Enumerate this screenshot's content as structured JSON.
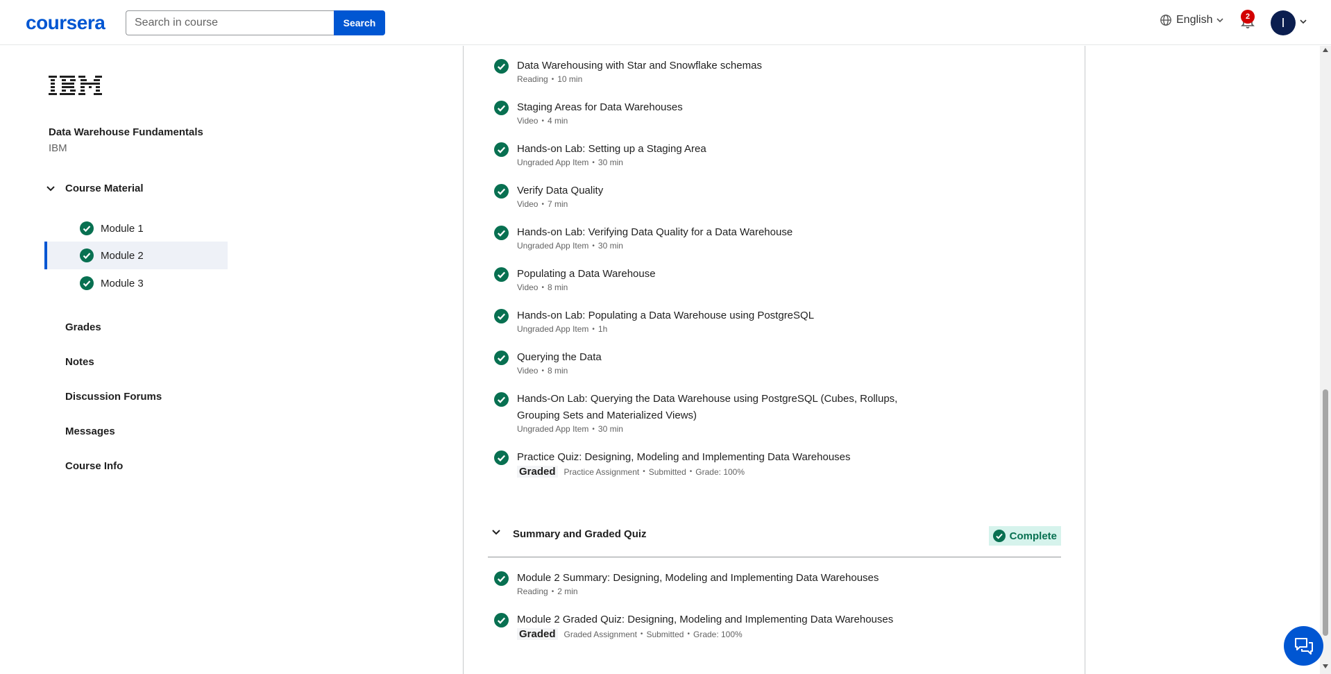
{
  "header": {
    "logo": "coursera",
    "search_placeholder": "Search in course",
    "search_button": "Search",
    "language": "English",
    "notifications_count": "2",
    "avatar_initial": "I"
  },
  "sidebar": {
    "course_title": "Data Warehouse Fundamentals",
    "course_org": "IBM",
    "course_material_label": "Course Material",
    "modules": [
      {
        "label": "Module 1",
        "completed": true,
        "active": false
      },
      {
        "label": "Module 2",
        "completed": true,
        "active": true
      },
      {
        "label": "Module 3",
        "completed": true,
        "active": false
      }
    ],
    "nav": [
      "Grades",
      "Notes",
      "Discussion Forums",
      "Messages",
      "Course Info"
    ]
  },
  "items": [
    {
      "title": "Data Warehousing with Star and Snowflake schemas",
      "type": "Reading",
      "duration": "10 min"
    },
    {
      "title": "Staging Areas for Data Warehouses",
      "type": "Video",
      "duration": "4 min"
    },
    {
      "title": "Hands-on Lab: Setting up a Staging Area",
      "type": "Ungraded App Item",
      "duration": "30 min"
    },
    {
      "title": "Verify Data Quality",
      "type": "Video",
      "duration": "7 min"
    },
    {
      "title": "Hands-on Lab: Verifying Data Quality for a Data Warehouse",
      "type": "Ungraded App Item",
      "duration": "30 min"
    },
    {
      "title": "Populating a Data Warehouse",
      "type": "Video",
      "duration": "8 min"
    },
    {
      "title": "Hands-on Lab: Populating a Data Warehouse using PostgreSQL",
      "type": "Ungraded App Item",
      "duration": "1h"
    },
    {
      "title": "Querying the Data",
      "type": "Video",
      "duration": "8 min"
    },
    {
      "title": "Hands-On Lab: Querying the Data Warehouse using PostgreSQL (Cubes, Rollups, Grouping Sets and Materialized Views)",
      "type": "Ungraded App Item",
      "duration": "30 min"
    },
    {
      "title": "Practice Quiz: Designing, Modeling and Implementing Data Warehouses",
      "tag": "Graded",
      "type": "Practice Assignment",
      "status": "Submitted",
      "grade": "Grade: 100%"
    }
  ],
  "summary_section": {
    "title": "Summary and Graded Quiz",
    "status": "Complete",
    "items": [
      {
        "title": "Module 2 Summary: Designing, Modeling and Implementing Data Warehouses",
        "type": "Reading",
        "duration": "2 min"
      },
      {
        "title": "Module 2 Graded Quiz: Designing, Modeling and Implementing Data Warehouses",
        "tag": "Graded",
        "type": "Graded Assignment",
        "status": "Submitted",
        "grade": "Grade: 100%"
      }
    ]
  },
  "colors": {
    "brand": "#0056d2",
    "success": "#087051",
    "success_bg": "#d6f3ec",
    "badge": "#d30001",
    "avatar": "#0b1e4f"
  }
}
